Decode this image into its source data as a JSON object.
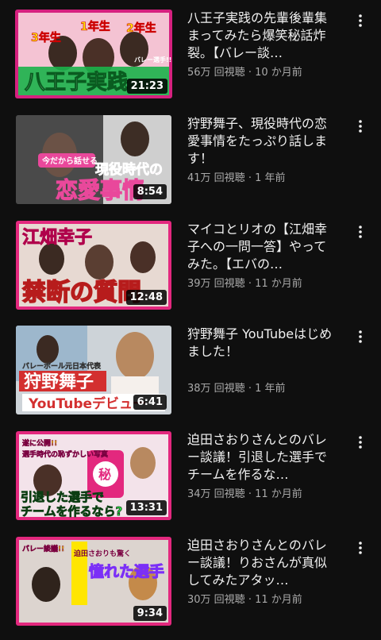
{
  "videos": [
    {
      "title": "八王子実践の先輩後輩集まってみたら爆笑秘話炸裂。【バレー談…",
      "views": "56万 回視聴",
      "age": "10 か月前",
      "duration": "21:23",
      "thumb_text": [
        "3年生",
        "1年生",
        "2年生",
        "バレー選手!!",
        "八王子実践"
      ],
      "thumb_colors": {
        "bg": "#d6207f",
        "accent": "#ffe600",
        "band": "#1bb34a"
      }
    },
    {
      "title": "狩野舞子、現役時代の恋愛事情をたっぷり話します！",
      "views": "41万 回視聴",
      "age": "1 年前",
      "duration": "8:54",
      "thumb_text": [
        "今だから話せる",
        "現役時代の",
        "恋愛事情"
      ],
      "thumb_colors": {
        "bg": "#3a3a3a",
        "accent": "#e9489b",
        "band": "#ffffff"
      }
    },
    {
      "title": "マイコとリオの【江畑幸子への一問一答】やってみた。【エバの…",
      "views": "39万 回視聴",
      "age": "11 か月前",
      "duration": "12:48",
      "thumb_text": [
        "江畑幸子",
        "禁断の質問"
      ],
      "thumb_colors": {
        "bg": "#e3287e",
        "accent": "#ffe600",
        "band": "#b71c1c"
      }
    },
    {
      "title": "狩野舞子 YouTubeはじめました！",
      "views": "38万 回視聴",
      "age": "1 年前",
      "duration": "6:41",
      "thumb_text": [
        "バレーボール元日本代表",
        "狩野舞子",
        "YouTubeデビュー"
      ],
      "thumb_colors": {
        "bg": "#cdd3d8",
        "accent": "#d32f2f",
        "band": "#ffffff"
      }
    },
    {
      "title": "迫田さおりさんとのバレー談議！引退した選手でチームを作るな…",
      "views": "34万 回視聴",
      "age": "11 か月前",
      "duration": "13:31",
      "thumb_text": [
        "遂に公開!!",
        "選手時代の恥ずかしい写真",
        "秘",
        "引退した選手で",
        "チームを作るなら?"
      ],
      "thumb_colors": {
        "bg": "#e3287e",
        "accent": "#2ee84a",
        "band": "#ffffff"
      }
    },
    {
      "title": "迫田さおりさんとのバレー談議！りおさんが真似してみたアタッ…",
      "views": "30万 回視聴",
      "age": "11 か月前",
      "duration": "9:34",
      "thumb_text": [
        "バレー談議!!",
        "憧れた選手",
        "迫田さおりも驚く"
      ],
      "thumb_colors": {
        "bg": "#e3287e",
        "accent": "#ffe600",
        "band": "#7b2ff7"
      }
    }
  ],
  "icons": {
    "menu": "more-vert-icon"
  }
}
